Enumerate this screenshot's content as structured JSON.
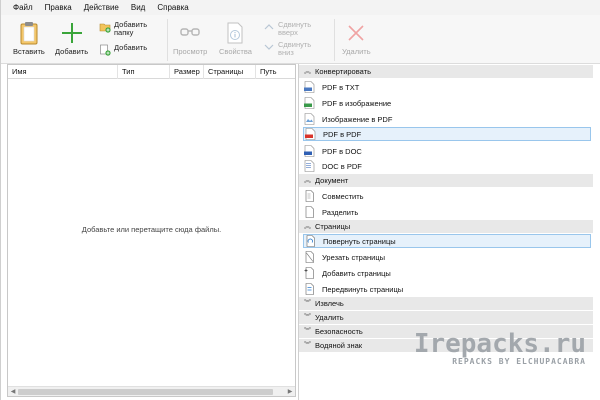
{
  "menu": [
    "Файл",
    "Правка",
    "Действие",
    "Вид",
    "Справка"
  ],
  "toolbar": {
    "insert_label": "Вставить",
    "add_label": "Добавить",
    "add_folder_label": "Добавить\nпапку",
    "add_small_label": "Добавить",
    "view_label": "Просмотр",
    "properties_label": "Свойства",
    "move_up_label": "Сдвинуть\nвверх",
    "move_down_label": "Сдвинуть\nвниз",
    "delete_label": "Удалить"
  },
  "file_list": {
    "columns": [
      "Имя",
      "Тип",
      "Размер",
      "Страницы",
      "Путь"
    ],
    "empty_hint": "Добавьте или перетащите сюда файлы."
  },
  "side_panel": {
    "sections": [
      {
        "title": "Конвертировать",
        "expanded": true,
        "actions": [
          {
            "label": "PDF в TXT",
            "icon": "pdf-to-txt-icon",
            "selected": false
          },
          {
            "label": "PDF в изображение",
            "icon": "pdf-to-image-icon",
            "selected": false
          },
          {
            "label": "Изображение в PDF",
            "icon": "image-to-pdf-icon",
            "selected": false
          },
          {
            "label": "PDF в PDF",
            "icon": "pdf-to-pdf-icon",
            "selected": true
          },
          {
            "label": "PDF в DOC",
            "icon": "pdf-to-doc-icon",
            "selected": false
          },
          {
            "label": "DOC в PDF",
            "icon": "doc-to-pdf-icon",
            "selected": false
          }
        ]
      },
      {
        "title": "Документ",
        "expanded": true,
        "actions": [
          {
            "label": "Совместить",
            "icon": "merge-icon",
            "selected": false
          },
          {
            "label": "Разделить",
            "icon": "split-icon",
            "selected": false
          }
        ]
      },
      {
        "title": "Страницы",
        "expanded": true,
        "actions": [
          {
            "label": "Повернуть страницы",
            "icon": "rotate-pages-icon",
            "selected": true
          },
          {
            "label": "Урезать страницы",
            "icon": "crop-pages-icon",
            "selected": false
          },
          {
            "label": "Добавить страницы",
            "icon": "add-pages-icon",
            "selected": false
          },
          {
            "label": "Передвинуть страницы",
            "icon": "move-pages-icon",
            "selected": false
          }
        ]
      },
      {
        "title": "Извлечь",
        "expanded": false,
        "actions": []
      },
      {
        "title": "Удалить",
        "expanded": false,
        "actions": []
      },
      {
        "title": "Безопасность",
        "expanded": false,
        "actions": []
      },
      {
        "title": "Водяной знак",
        "expanded": false,
        "actions": []
      }
    ]
  },
  "watermark": {
    "site": "Irepacks.ru",
    "credit": "REPACKS BY ELCHUPACABRA"
  },
  "colors": {
    "selection_bg": "#e6f1fb",
    "selection_border": "#99c6ec",
    "section_bg": "#e8e8e8",
    "add_green": "#3aa53a",
    "delete_red": "#e05a5a",
    "pdf_red": "#d9342b"
  }
}
